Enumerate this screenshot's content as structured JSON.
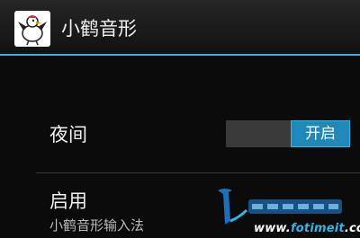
{
  "app_bar": {
    "title": "小鹤音形",
    "icon": "crane-app-icon"
  },
  "settings": {
    "night_mode": {
      "label": "夜间",
      "toggle_state": "开启",
      "enabled": true
    },
    "enable_ime": {
      "label": "启用",
      "summary": "小鹤音形输入法"
    }
  },
  "watermark": {
    "url_prefix": "www.",
    "url_brand": "fotimeit",
    "url_suffix": ".com"
  },
  "colors": {
    "accent": "#33b5e5",
    "toggle_on": "#1f88b8",
    "background": "#000000"
  }
}
